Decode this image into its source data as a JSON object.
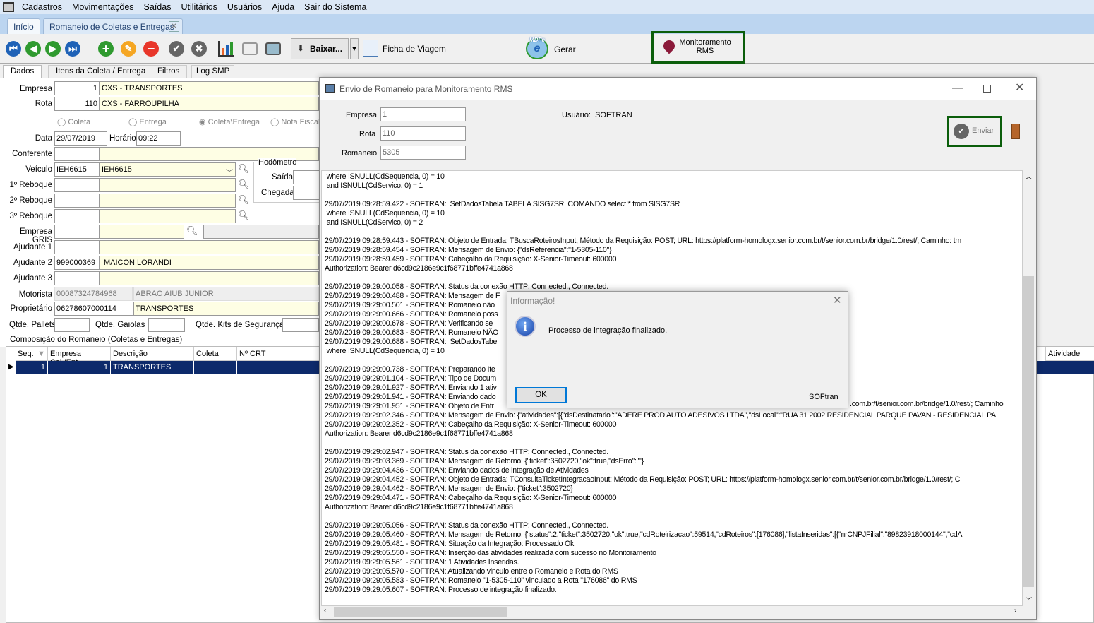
{
  "menu": [
    "Cadastros",
    "Movimentações",
    "Saídas",
    "Utilitários",
    "Usuários",
    "Ajuda",
    "Sair do Sistema"
  ],
  "tabs": {
    "home": "Início",
    "active": "Romaneio de Coletas e Entregas"
  },
  "toolbar": {
    "baixar": "Baixar...",
    "ficha": "Ficha de Viagem",
    "gerar": "Gerar",
    "monitoramento_1": "Monitoramento",
    "monitoramento_2": "RMS",
    "mdfe": "MDFe",
    "highlight_color": "#0b5e0b"
  },
  "subtabs": [
    "Dados",
    "Itens da Coleta / Entrega",
    "Filtros",
    "Log SMP"
  ],
  "form": {
    "empresa": {
      "label": "Empresa",
      "code": "1",
      "desc": "CXS - TRANSPORTES"
    },
    "rota": {
      "label": "Rota",
      "code": "110",
      "desc": "CXS - FARROUPILHA"
    },
    "radios": [
      "Coleta",
      "Entrega",
      "Coleta\\Entrega",
      "Nota Fiscal"
    ],
    "radio_selected": "Coleta\\Entrega",
    "data": {
      "label": "Data",
      "value": "29/07/2019"
    },
    "horario": {
      "label": "Horário",
      "value": "09:22"
    },
    "conferente": {
      "label": "Conferente",
      "code": "",
      "desc": ""
    },
    "veiculo": {
      "label": "Veículo",
      "code": "IEH6615",
      "desc": "IEH6615"
    },
    "reboque1": {
      "label": "1º Reboque"
    },
    "reboque2": {
      "label": "2º Reboque"
    },
    "reboque3": {
      "label": "3º Reboque"
    },
    "hodometro": {
      "title": "Hodômetro",
      "saida": "Saída",
      "chegada": "Chegada"
    },
    "empresa_gris": {
      "label": "Empresa GRIS"
    },
    "ajudante1": {
      "label": "Ajudante 1"
    },
    "ajudante2": {
      "label": "Ajudante 2",
      "code": "999000369",
      "desc": "MAICON LORANDI"
    },
    "ajudante3": {
      "label": "Ajudante 3"
    },
    "motorista": {
      "label": "Motorista",
      "code": "00087324784968",
      "desc": "ABRAO AIUB JUNIOR"
    },
    "proprietario": {
      "label": "Proprietário",
      "code": "06278607000114",
      "desc": "TRANSPORTES"
    },
    "pallets": "Qtde. Pallets",
    "gaiolas": "Qtde. Gaiolas",
    "kits": "Qtde. Kits de Segurança"
  },
  "grid": {
    "title": "Composição do Romaneio (Coletas e Entregas)",
    "columns": [
      "Seq.",
      "Empresa Col./Ent.",
      "Descrição",
      "Coleta",
      "Nº CRT",
      "Atividade"
    ],
    "rows": [
      {
        "seq": "1",
        "empresa": "1",
        "descricao": "TRANSPORTES"
      }
    ]
  },
  "rms": {
    "title": "Envio de Romaneio para Monitoramento RMS",
    "empresa_label": "Empresa",
    "empresa": "1",
    "rota_label": "Rota",
    "rota": "110",
    "romaneio_label": "Romaneio",
    "romaneio": "5305",
    "usuario_label": "Usuário:",
    "usuario": "SOFTRAN",
    "enviar": "Enviar",
    "log": [
      " where ISNULL(CdSequencia, 0) = 10",
      " and ISNULL(CdServico, 0) = 1",
      "",
      "29/07/2019 09:28:59.422 - SOFTRAN:  SetDadosTabela TABELA SISG7SR, COMANDO select * from SISG7SR",
      " where ISNULL(CdSequencia, 0) = 10",
      " and ISNULL(CdServico, 0) = 2",
      "",
      "29/07/2019 09:28:59.443 - SOFTRAN: Objeto de Entrada: TBuscaRoteirosInput; Método da Requisição: POST; URL: https://platform-homologx.senior.com.br/t/senior.com.br/bridge/1.0/rest/; Caminho: tm",
      "29/07/2019 09:28:59.454 - SOFTRAN: Mensagem de Envio: {\"dsReferencia\":\"1-5305-110\"}",
      "29/07/2019 09:28:59.459 - SOFTRAN: Cabeçalho da Requisição: X-Senior-Timeout: 600000",
      "Authorization: Bearer d6cd9c2186e9c1f68771bffe4741a868",
      "",
      "29/07/2019 09:29:00.058 - SOFTRAN: Status da conexão HTTP: Connected., Connected.",
      "29/07/2019 09:29:00.488 - SOFTRAN: Mensagem de F",
      "29/07/2019 09:29:00.501 - SOFTRAN: Romaneio não",
      "29/07/2019 09:29:00.666 - SOFTRAN: Romaneio poss",
      "29/07/2019 09:29:00.678 - SOFTRAN: Verificando se",
      "29/07/2019 09:29:00.683 - SOFTRAN: Romaneio NÃO",
      "29/07/2019 09:29:00.688 - SOFTRAN:  SetDadosTabe",
      " where ISNULL(CdSequencia, 0) = 10",
      "",
      "29/07/2019 09:29:00.738 - SOFTRAN: Preparando Ite",
      "29/07/2019 09:29:01.104 - SOFTRAN: Tipo de Docum",
      "29/07/2019 09:29:01.927 - SOFTRAN: Enviando 1 ativ",
      "29/07/2019 09:29:01.941 - SOFTRAN: Enviando dado",
      "29/07/2019 09:29:01.951 - SOFTRAN: Objeto de Entr",
      "29/07/2019 09:29:02.346 - SOFTRAN: Mensagem de Envio: {\"atividades\":[{\"dsDestinatario\":\"ADERE PROD AUTO ADESIVOS LTDA\",\"dsLocal\":\"RUA 31 2002 RESIDENCIAL PARQUE PAVAN - RESIDENCIAL PA",
      "29/07/2019 09:29:02.352 - SOFTRAN: Cabeçalho da Requisição: X-Senior-Timeout: 600000",
      "Authorization: Bearer d6cd9c2186e9c1f68771bffe4741a868",
      "",
      "29/07/2019 09:29:02.947 - SOFTRAN: Status da conexão HTTP: Connected., Connected.",
      "29/07/2019 09:29:03.369 - SOFTRAN: Mensagem de Retorno: {\"ticket\":3502720,\"ok\":true,\"dsErro\":\"\"}",
      "29/07/2019 09:29:04.436 - SOFTRAN: Enviando dados de integração de Atividades",
      "29/07/2019 09:29:04.452 - SOFTRAN: Objeto de Entrada: TConsultaTicketIntegracaoInput; Método da Requisição: POST; URL: https://platform-homologx.senior.com.br/t/senior.com.br/bridge/1.0/rest/; C",
      "29/07/2019 09:29:04.462 - SOFTRAN: Mensagem de Envio: {\"ticket\":3502720}",
      "29/07/2019 09:29:04.471 - SOFTRAN: Cabeçalho da Requisição: X-Senior-Timeout: 600000",
      "Authorization: Bearer d6cd9c2186e9c1f68771bffe4741a868",
      "",
      "29/07/2019 09:29:05.056 - SOFTRAN: Status da conexão HTTP: Connected., Connected.",
      "29/07/2019 09:29:05.460 - SOFTRAN: Mensagem de Retorno: {\"status\":2,\"ticket\":3502720,\"ok\":true,\"cdRoteirizacao\":59514,\"cdRoteiros\":[176086],\"listaInseridas\":[{\"nrCNPJFilial\":\"89823918000144\",\"cdA",
      "29/07/2019 09:29:05.481 - SOFTRAN: Situação da Integração: Processado Ok",
      "29/07/2019 09:29:05.550 - SOFTRAN: Inserção das atividades realizada com sucesso no Monitoramento",
      "29/07/2019 09:29:05.561 - SOFTRAN: 1 Atividades Inseridas.",
      "29/07/2019 09:29:05.570 - SOFTRAN: Atualizando vinculo entre o Romaneio e Rota do RMS",
      "29/07/2019 09:29:05.583 - SOFTRAN: Romaneio \"1-5305-110\" vinculado a Rota \"176086\" do RMS",
      "29/07/2019 09:29:05.607 - SOFTRAN: Processo de integração finalizado."
    ],
    "log_tail": ".com.br/t/senior.com.br/bridge/1.0/rest/; Caminho"
  },
  "info": {
    "title": "Informação!",
    "message": "Processo de integração finalizado.",
    "ok": "OK",
    "brand": "SOFtran"
  }
}
